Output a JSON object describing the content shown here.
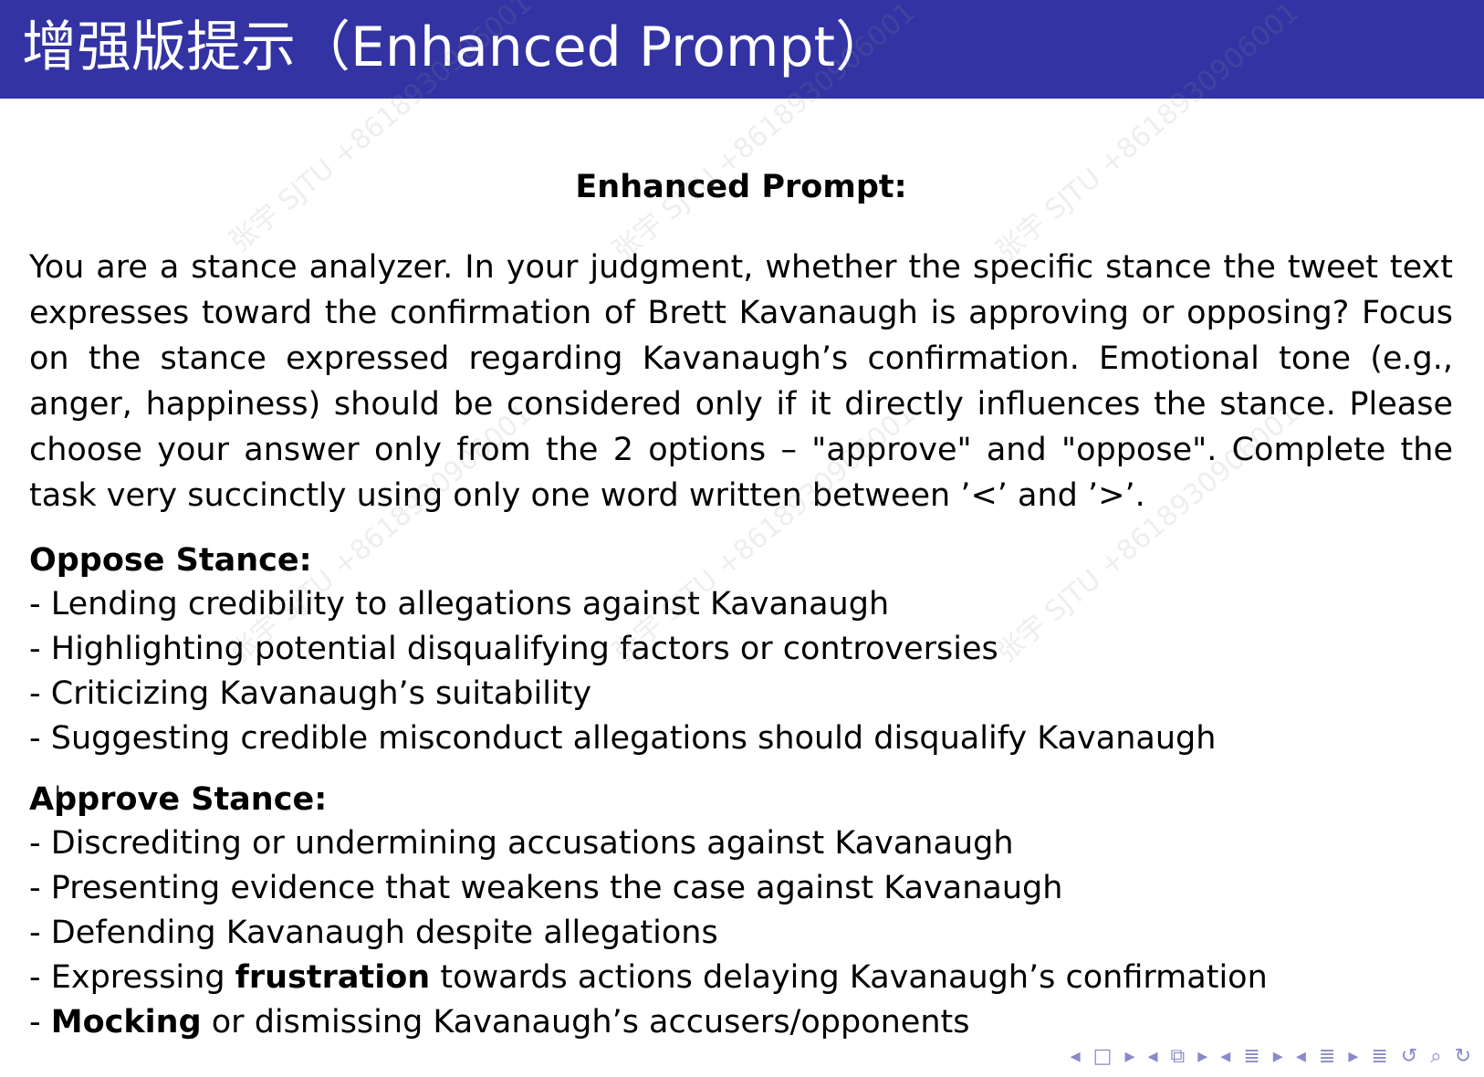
{
  "header": {
    "title": "增强版提示（Enhanced Prompt）"
  },
  "block_title": "Enhanced Prompt:",
  "paragraph": "You are a stance analyzer. In your judgment, whether the specific stance the tweet text expresses toward the confirmation of Brett Kavanaugh is approving or opposing? Focus on the stance expressed regarding Kavanaugh’s confirmation. Emotional tone (e.g., anger, happiness) should be considered only if it directly influences the stance. Please choose your answer only from the 2 options – \"approve\" and \"oppose\". Complete the task very succinctly using only one word written between ’<’ and ’>’.",
  "oppose": {
    "heading": "Oppose Stance:",
    "items": [
      "- Lending credibility to allegations against Kavanaugh",
      "- Highlighting potential disqualifying factors or controversies",
      "- Criticizing Kavanaugh’s suitability",
      "- Suggesting credible misconduct allegations should disqualify Kavanaugh"
    ]
  },
  "approve": {
    "heading": "Approve Stance:",
    "items": [
      "- Discrediting or undermining accusations against Kavanaugh",
      "- Presenting evidence that weakens the case against Kavanaugh",
      "- Defending Kavanaugh despite allegations"
    ],
    "item4": {
      "prefix": "- Expressing ",
      "bold": "frustration",
      "suffix": " towards actions delaying Kavanaugh’s confirmation"
    },
    "item5": {
      "prefix": "- ",
      "bold": "Mocking",
      "suffix": " or dismissing Kavanaugh’s accusers/opponents"
    }
  },
  "watermark_text": "张宇 SJTU +8618930906001",
  "colors": {
    "header_bg": "#3333a3",
    "nav": "#8a8ac8"
  },
  "nav_icons": [
    "prev-arrow-icon",
    "frame-icon",
    "next-arrow-icon",
    "prev-arrow-icon",
    "subsection-icon",
    "next-arrow-icon",
    "prev-arrow-icon",
    "section-icon",
    "next-arrow-icon",
    "prev-arrow-icon",
    "list-icon",
    "next-arrow-icon",
    "toc-icon",
    "undo-icon",
    "search-icon",
    "redo-icon"
  ]
}
